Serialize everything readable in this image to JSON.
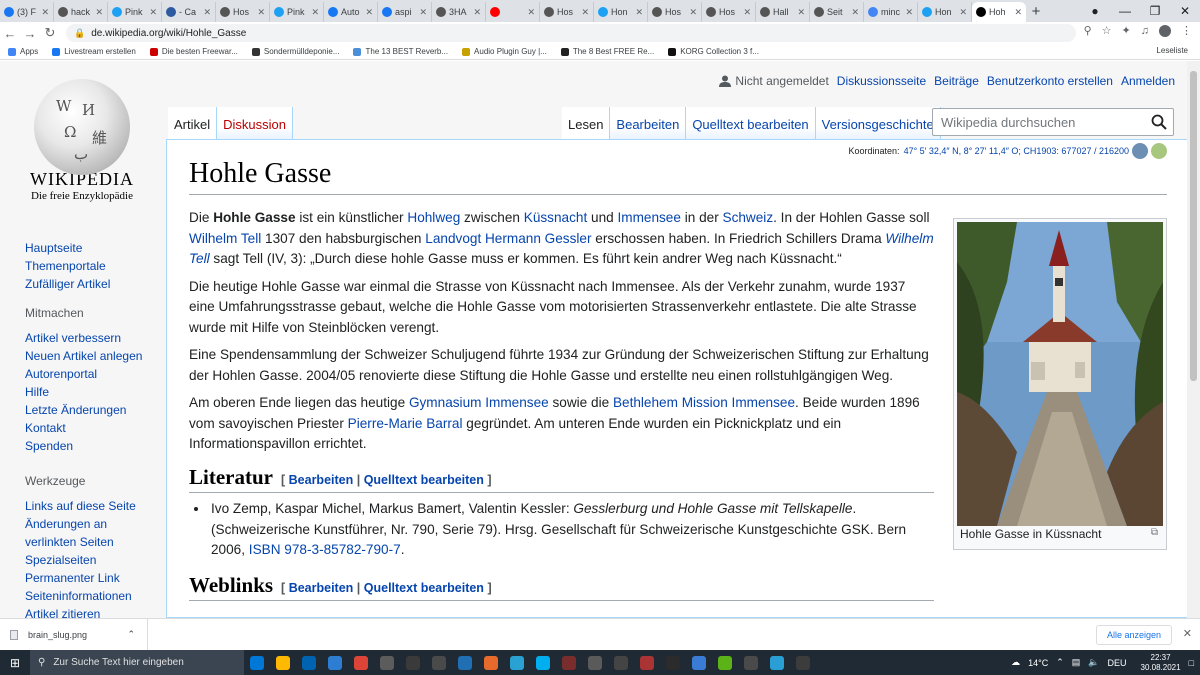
{
  "browser": {
    "tabs": [
      {
        "label": "(3) F",
        "color": "#1877f2"
      },
      {
        "label": "hack",
        "color": "#555"
      },
      {
        "label": "Pink",
        "color": "#1da1f2"
      },
      {
        "label": "- Ca",
        "color": "#2d5aa0"
      },
      {
        "label": "Hos",
        "color": "#555"
      },
      {
        "label": "Pink",
        "color": "#1da1f2"
      },
      {
        "label": "Auto",
        "color": "#1877f2"
      },
      {
        "label": "aspi",
        "color": "#1877f2"
      },
      {
        "label": "3HA",
        "color": "#555"
      },
      {
        "label": "",
        "color": "#ff0000"
      },
      {
        "label": "Hos",
        "color": "#555"
      },
      {
        "label": "Hon",
        "color": "#1da1f2"
      },
      {
        "label": "Hos",
        "color": "#555"
      },
      {
        "label": "Hos",
        "color": "#555"
      },
      {
        "label": "Hall",
        "color": "#555"
      },
      {
        "label": "Seit",
        "color": "#555"
      },
      {
        "label": "minc",
        "color": "#4285f4"
      },
      {
        "label": "Hon",
        "color": "#1da1f2"
      },
      {
        "label": "Hoh",
        "color": "#000"
      }
    ],
    "url": "de.wikipedia.org/wiki/Hohle_Gasse",
    "bookmarks": [
      {
        "label": "Apps",
        "color": "#4285f4"
      },
      {
        "label": "Livestream erstellen",
        "color": "#1877f2"
      },
      {
        "label": "Die besten Freewar...",
        "color": "#c00"
      },
      {
        "label": "Sondermülldeponie...",
        "color": "#333"
      },
      {
        "label": "The 13 BEST Reverb...",
        "color": "#4a90d9"
      },
      {
        "label": "Audio Plugin Guy |...",
        "color": "#c8a000"
      },
      {
        "label": "The 8 Best FREE Re...",
        "color": "#222"
      },
      {
        "label": "KORG Collection 3 f...",
        "color": "#111"
      }
    ],
    "reading_list": "Leseliste"
  },
  "wiki": {
    "logo_title": "Wikipedia",
    "logo_tagline": "Die freie Enzyklopädie",
    "personal": {
      "not_logged": "Nicht angemeldet",
      "links": [
        "Diskussionsseite",
        "Beiträge",
        "Benutzerkonto erstellen",
        "Anmelden"
      ]
    },
    "nav_main": [
      "Hauptseite",
      "Themenportale",
      "Zufälliger Artikel"
    ],
    "sec_mitmachen": "Mitmachen",
    "nav_mitmachen": [
      "Artikel verbessern",
      "Neuen Artikel anlegen",
      "Autorenportal",
      "Hilfe",
      "Letzte Änderungen",
      "Kontakt",
      "Spenden"
    ],
    "sec_werkzeuge": "Werkzeuge",
    "nav_werkzeuge": [
      "Links auf diese Seite",
      "Änderungen an verlinkten Seiten",
      "Spezialseiten",
      "Permanenter Link",
      "Seiteninformationen",
      "Artikel zitieren"
    ],
    "tabs_left": [
      "Artikel",
      "Diskussion"
    ],
    "tabs_right": [
      "Lesen",
      "Bearbeiten",
      "Quelltext bearbeiten",
      "Versionsgeschichte"
    ],
    "search_placeholder": "Wikipedia durchsuchen",
    "coords_label": "Koordinaten:",
    "coords_value": "47° 5′ 32,4″ N, 8° 27′ 11,4″ O; CH1903: 677027 / 216200",
    "title": "Hohle Gasse",
    "thumb_caption": "Hohle Gasse in Küssnacht",
    "edit_open": "[",
    "edit_close": "]",
    "edit_bearbeiten": "Bearbeiten",
    "edit_sep": " | ",
    "edit_quelltext": "Quelltext bearbeiten",
    "literatur": "Literatur",
    "weblinks": "Weblinks",
    "p1": {
      "t1": "Die ",
      "b1": "Hohle Gasse",
      "t2": " ist ein künstlicher ",
      "a1": "Hohlweg",
      "t3": " zwischen ",
      "a2": "Küssnacht",
      "t4": " und ",
      "a3": "Immensee",
      "t5": " in der ",
      "a4": "Schweiz",
      "t6": ". In der Hohlen Gasse soll ",
      "a5": "Wilhelm Tell",
      "t7": " 1307 den habsburgischen ",
      "a6": "Landvogt Hermann Gessler",
      "t8": " erschossen haben. In Friedrich Schillers Drama ",
      "a7": "Wilhelm Tell",
      "t9": " sagt Tell (IV, 3): „Durch diese hohle Gasse muss er kommen. Es führt kein andrer Weg nach Küssnacht.“"
    },
    "p2": "Die heutige Hohle Gasse war einmal die Strasse von Küssnacht nach Immensee. Als der Verkehr zunahm, wurde 1937 eine Umfahrungsstrasse gebaut, welche die Hohle Gasse vom motorisierten Strassenverkehr entlastete. Die alte Strasse wurde mit Hilfe von Steinblöcken verengt.",
    "p3": "Eine Spendensammlung der Schweizer Schuljugend führte 1934 zur Gründung der Schweizerischen Stiftung zur Erhaltung der Hohlen Gasse. 2004/05 renovierte diese Stiftung die Hohle Gasse und erstellte neu einen rollstuhlgängigen Weg.",
    "p4": {
      "t1": "Am oberen Ende liegen das heutige ",
      "a1": "Gymnasium Immensee",
      "t2": " sowie die ",
      "a2": "Bethlehem Mission Immensee",
      "t3": ". Beide wurden 1896 vom savoyischen Priester ",
      "a3": "Pierre-Marie Barral",
      "t4": " gegründet. Am unteren Ende wurden ein Picknickplatz und ein Informationspavillon errichtet."
    },
    "lit1": {
      "t1": "Ivo Zemp, Kaspar Michel, Markus Bamert, Valentin Kessler: ",
      "i1": "Gesslerburg und Hohle Gasse mit Tellskapelle",
      "t2": ". (Schweizerische Kunstführer, Nr. 790, Serie 79). Hrsg. Gesellschaft für Schweizerische Kunstgeschichte GSK. Bern 2006, ",
      "a1": "ISBN 978-3-85782-790-7",
      "t3": "."
    }
  },
  "downloads": {
    "file": "brain_slug.png",
    "show_all": "Alle anzeigen"
  },
  "taskbar": {
    "search_placeholder": "Zur Suche Text hier eingeben",
    "weather": "14°C",
    "lang": "DEU",
    "time": "22:37",
    "date": "30.08.2021"
  }
}
